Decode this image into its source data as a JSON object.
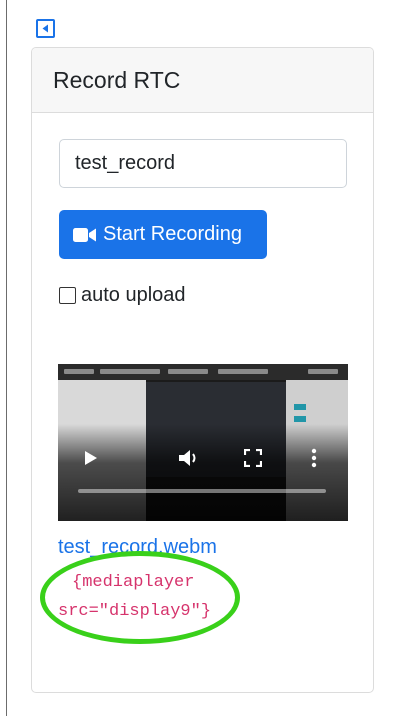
{
  "card": {
    "title": "Record RTC"
  },
  "recorder": {
    "file_name_value": "test_record",
    "start_button_label": "Start Recording",
    "auto_upload_label": "auto upload",
    "auto_upload_checked": false
  },
  "recording": {
    "file_link": "test_record.webm",
    "embed_line1": "{mediaplayer",
    "embed_line2": "src=\"display9\"}"
  },
  "icons": {
    "collapse": "chevron-left-icon",
    "camera": "video-camera-icon",
    "play": "play-icon",
    "volume": "volume-icon",
    "fullscreen": "fullscreen-icon",
    "menu": "more-vertical-icon"
  },
  "colors": {
    "primary": "#1a73e8",
    "code": "#d6336c",
    "annotation": "#39d01a"
  }
}
